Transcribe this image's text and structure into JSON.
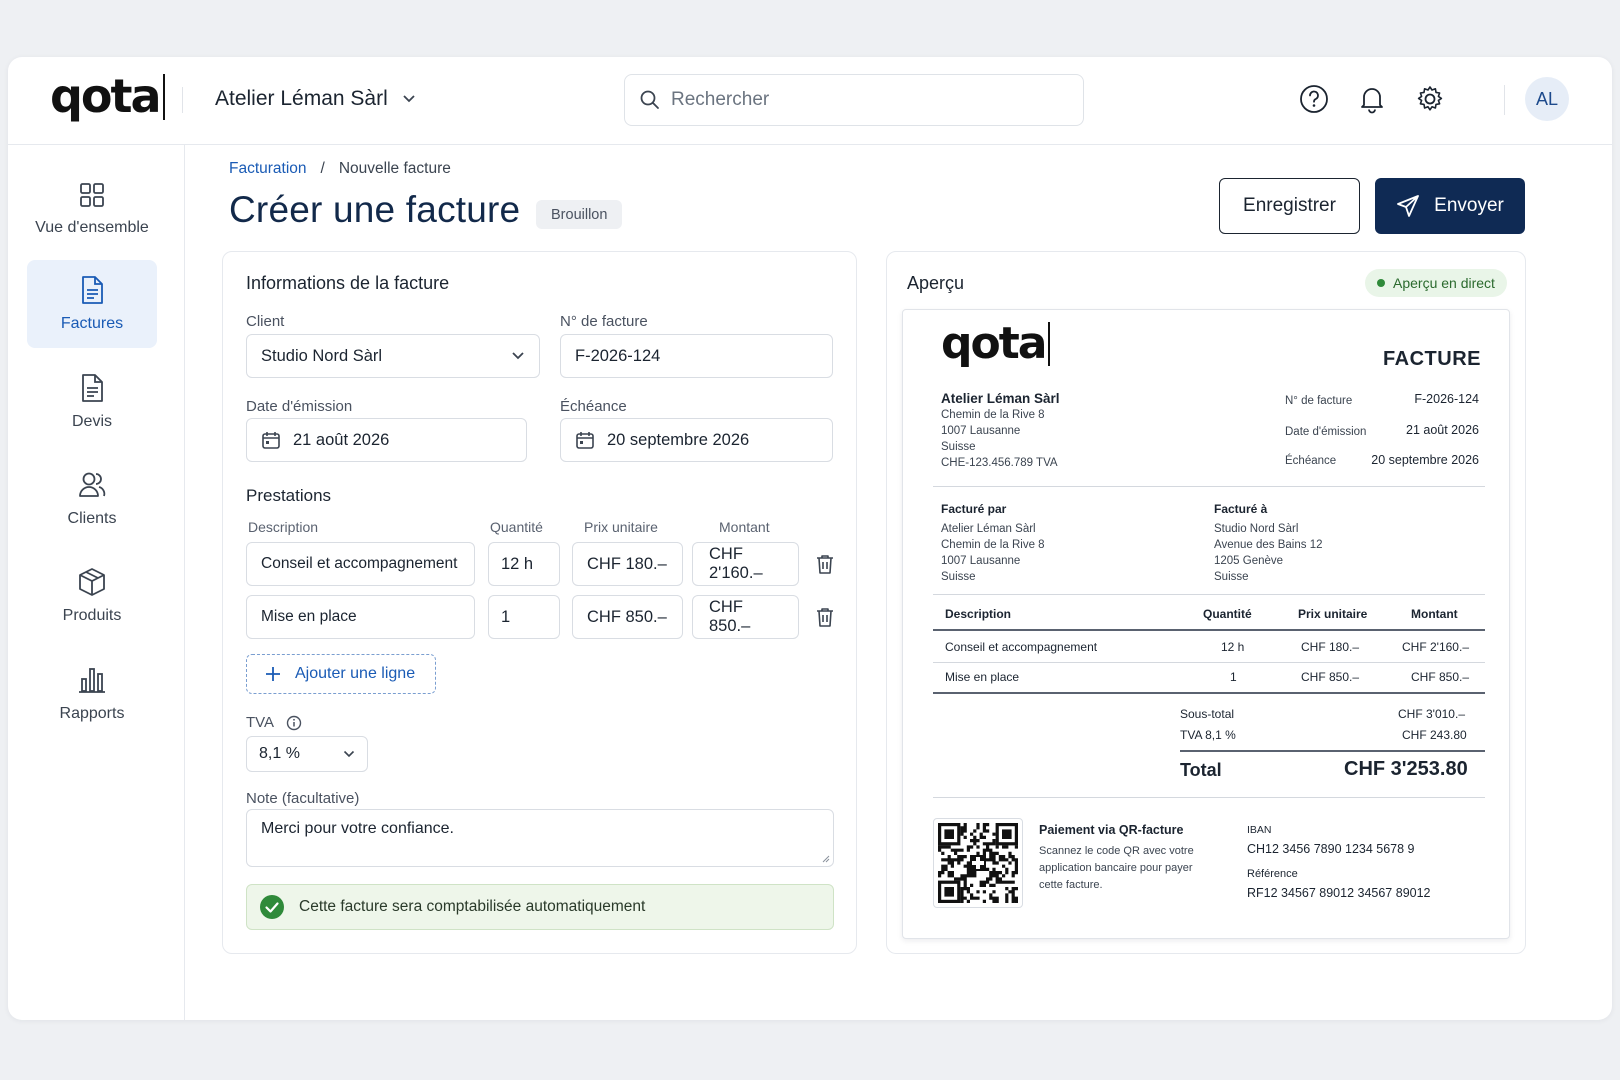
{
  "topbar": {
    "logo": "qota",
    "org_name": "Atelier Léman Sàrl",
    "search_placeholder": "Rechercher",
    "avatar_initials": "AL"
  },
  "sidebar": {
    "items": [
      {
        "label": "Vue d'ensemble",
        "icon": "grid-icon",
        "active": false
      },
      {
        "label": "Factures",
        "icon": "invoice-icon",
        "active": true
      },
      {
        "label": "Devis",
        "icon": "document-icon",
        "active": false
      },
      {
        "label": "Clients",
        "icon": "users-icon",
        "active": false
      },
      {
        "label": "Produits",
        "icon": "box-icon",
        "active": false
      },
      {
        "label": "Rapports",
        "icon": "bar-chart-icon",
        "active": false
      }
    ]
  },
  "header": {
    "breadcrumb_root": "Facturation",
    "breadcrumb_sep": "/",
    "breadcrumb_current": "Nouvelle facture",
    "title": "Créer une facture",
    "status_badge": "Brouillon",
    "save_label": "Enregistrer",
    "send_label": "Envoyer"
  },
  "form": {
    "section_title": "Informations de la facture",
    "client_label": "Client",
    "client_value": "Studio Nord Sàrl",
    "invoice_no_label": "N° de facture",
    "invoice_no_value": "F-2026-124",
    "issue_date_label": "Date d'émission",
    "issue_date_value": "21 août 2026",
    "due_date_label": "Échéance",
    "due_date_value": "20 septembre 2026",
    "services_title": "Prestations",
    "columns": {
      "description": "Description",
      "quantity": "Quantité",
      "unit_price": "Prix unitaire",
      "amount": "Montant"
    },
    "lines": [
      {
        "description": "Conseil et accompagnement",
        "quantity": "12 h",
        "unit_price": "CHF 180.–",
        "amount": "CHF 2'160.–"
      },
      {
        "description": "Mise en place",
        "quantity": "1",
        "unit_price": "CHF 850.–",
        "amount": "CHF 850.–"
      }
    ],
    "add_line_label": "Ajouter une ligne",
    "vat_label": "TVA",
    "vat_value": "8,1 %",
    "note_label": "Note (facultative)",
    "note_value": "Merci pour votre confiance.",
    "notice": "Cette facture sera comptabilisée automatiquement"
  },
  "preview": {
    "title": "Aperçu",
    "live_badge": "Aperçu en direct",
    "logo": "qota",
    "doc_title": "FACTURE",
    "sender_name": "Atelier Léman Sàrl",
    "sender_address": [
      "Chemin de la Rive 8",
      "1007 Lausanne",
      "Suisse",
      "CHE-123.456.789 TVA"
    ],
    "meta": [
      {
        "label": "N° de facture",
        "value": "F-2026-124"
      },
      {
        "label": "Date d'émission",
        "value": "21 août 2026"
      },
      {
        "label": "Échéance",
        "value": "20 septembre 2026"
      }
    ],
    "billed_by_label": "Facturé par",
    "billed_by_name": "Atelier Léman Sàrl",
    "billed_by_address": [
      "Chemin de la Rive 8",
      "1007 Lausanne",
      "Suisse"
    ],
    "billed_to_label": "Facturé à",
    "billed_to_name": "Studio Nord Sàrl",
    "billed_to_address": [
      "Avenue des Bains 12",
      "1205 Genève",
      "Suisse"
    ],
    "table_headers": {
      "description": "Description",
      "quantity": "Quantité",
      "unit_price": "Prix unitaire",
      "amount": "Montant"
    },
    "table_rows": [
      {
        "description": "Conseil et accompagnement",
        "quantity": "12 h",
        "unit_price": "CHF 180.–",
        "amount": "CHF 2'160.–"
      },
      {
        "description": "Mise en place",
        "quantity": "1",
        "unit_price": "CHF 850.–",
        "amount": "CHF 850.–"
      }
    ],
    "subtotal_label": "Sous-total",
    "subtotal_value": "CHF 3'010.–",
    "vat_label": "TVA 8,1 %",
    "vat_value": "CHF 243.80",
    "total_label": "Total",
    "total_value": "CHF 3'253.80",
    "payment_title": "Paiement via QR-facture",
    "payment_text": [
      "Scannez le code QR avec votre",
      "application bancaire pour payer",
      "cette facture."
    ],
    "iban_label": "IBAN",
    "iban_value": "CH12 3456 7890 1234 5678 9",
    "reference_label": "Référence",
    "reference_value": "RF12 34567 89012 34567 89012"
  },
  "colors": {
    "primary": "#0f2a54",
    "accent": "#1a5bb5",
    "success": "#2f8a3a",
    "background": "#eef0f3"
  }
}
